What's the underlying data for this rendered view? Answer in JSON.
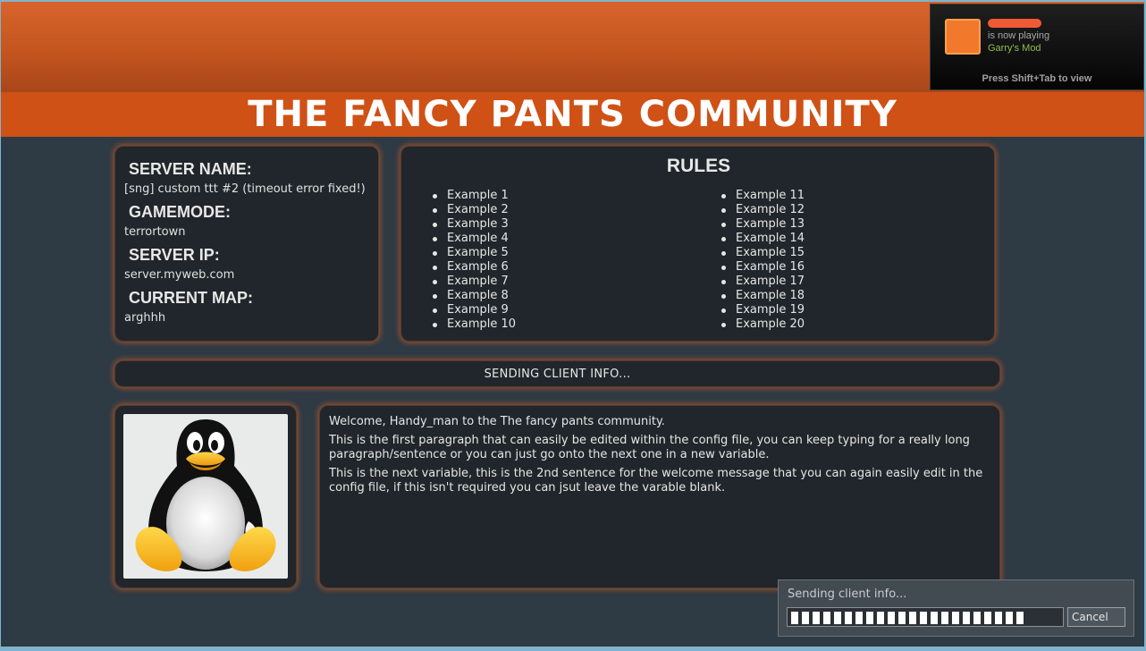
{
  "header": {
    "title": "THE FANCY PANTS COMMUNITY"
  },
  "server_info": {
    "server_name_label": "SERVER NAME:",
    "server_name": "[sng] custom ttt #2 (timeout error fixed!)",
    "gamemode_label": "GAMEMODE:",
    "gamemode": "terrortown",
    "server_ip_label": "SERVER IP:",
    "server_ip": "server.myweb.com",
    "current_map_label": "CURRENT MAP:",
    "current_map": "arghhh"
  },
  "rules": {
    "title": "RULES",
    "items": [
      "Example 1",
      "Example 2",
      "Example 3",
      "Example 4",
      "Example 5",
      "Example 6",
      "Example 7",
      "Example 8",
      "Example 9",
      "Example 10",
      "Example 11",
      "Example 12",
      "Example 13",
      "Example 14",
      "Example 15",
      "Example 16",
      "Example 17",
      "Example 18",
      "Example 19",
      "Example 20"
    ]
  },
  "status": {
    "text": "SENDING CLIENT INFO..."
  },
  "welcome": {
    "line1": "Welcome, Handy_man to the The fancy pants community.",
    "line2": "This is the first paragraph that can easily be edited within the config file, you can keep typing for a really long paragraph/sentence or you can just go onto the next one in a new variable.",
    "line3": "This is the next variable, this is the 2nd sentence for the welcome message that you can again easily edit in the config file, if this isn't required you can jsut leave the varable blank."
  },
  "avatar": {
    "icon": "tux-penguin-icon"
  },
  "steam_popup": {
    "status": "is now playing",
    "game": "Garry's Mod",
    "hint": "Press Shift+Tab to view"
  },
  "loading_dialog": {
    "text": "Sending client info...",
    "cancel_label": "Cancel",
    "progress_segments_filled": 22
  },
  "colors": {
    "accent_orange": "#cf5116",
    "panel_bg": "#20262b",
    "page_bg": "#2e3a44",
    "steam_game_green": "#8dbf4e"
  }
}
